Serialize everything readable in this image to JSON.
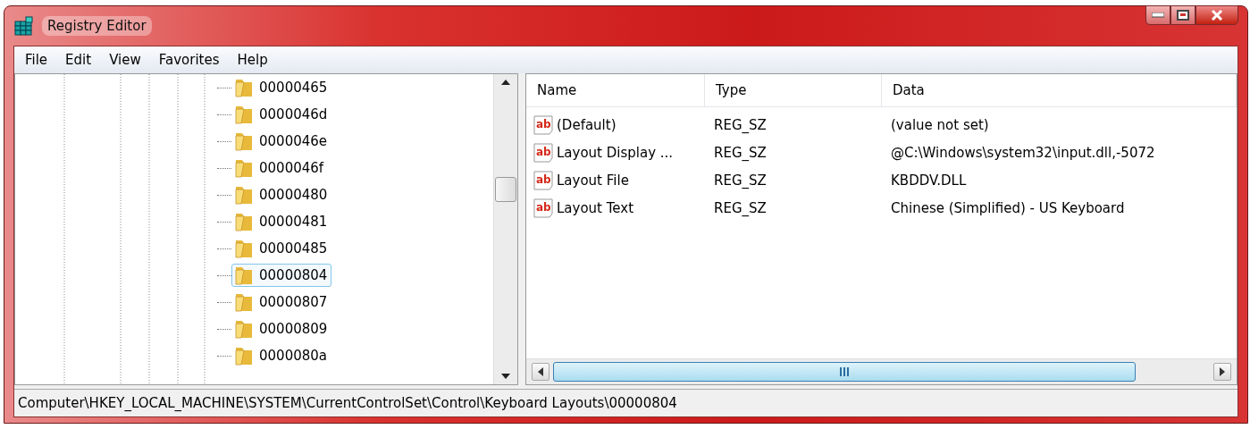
{
  "window": {
    "title": "Registry Editor"
  },
  "menu": [
    "File",
    "Edit",
    "View",
    "Favorites",
    "Help"
  ],
  "tree": {
    "items": [
      {
        "label": "00000465",
        "selected": false
      },
      {
        "label": "0000046d",
        "selected": false
      },
      {
        "label": "0000046e",
        "selected": false
      },
      {
        "label": "0000046f",
        "selected": false
      },
      {
        "label": "00000480",
        "selected": false
      },
      {
        "label": "00000481",
        "selected": false
      },
      {
        "label": "00000485",
        "selected": false
      },
      {
        "label": "00000804",
        "selected": true
      },
      {
        "label": "00000807",
        "selected": false
      },
      {
        "label": "00000809",
        "selected": false
      },
      {
        "label": "0000080a",
        "selected": false
      }
    ]
  },
  "values": {
    "columns": [
      "Name",
      "Type",
      "Data"
    ],
    "rows": [
      {
        "icon": "ab",
        "name": "(Default)",
        "type": "REG_SZ",
        "data": "(value not set)"
      },
      {
        "icon": "ab",
        "name": "Layout Display ...",
        "type": "REG_SZ",
        "data": "@C:\\Windows\\system32\\input.dll,-5072"
      },
      {
        "icon": "ab",
        "name": "Layout File",
        "type": "REG_SZ",
        "data": "KBDDV.DLL"
      },
      {
        "icon": "ab",
        "name": "Layout Text",
        "type": "REG_SZ",
        "data": "Chinese (Simplified) - US Keyboard"
      }
    ]
  },
  "status_bar": "Computer\\HKEY_LOCAL_MACHINE\\SYSTEM\\CurrentControlSet\\Control\\Keyboard Layouts\\00000804"
}
